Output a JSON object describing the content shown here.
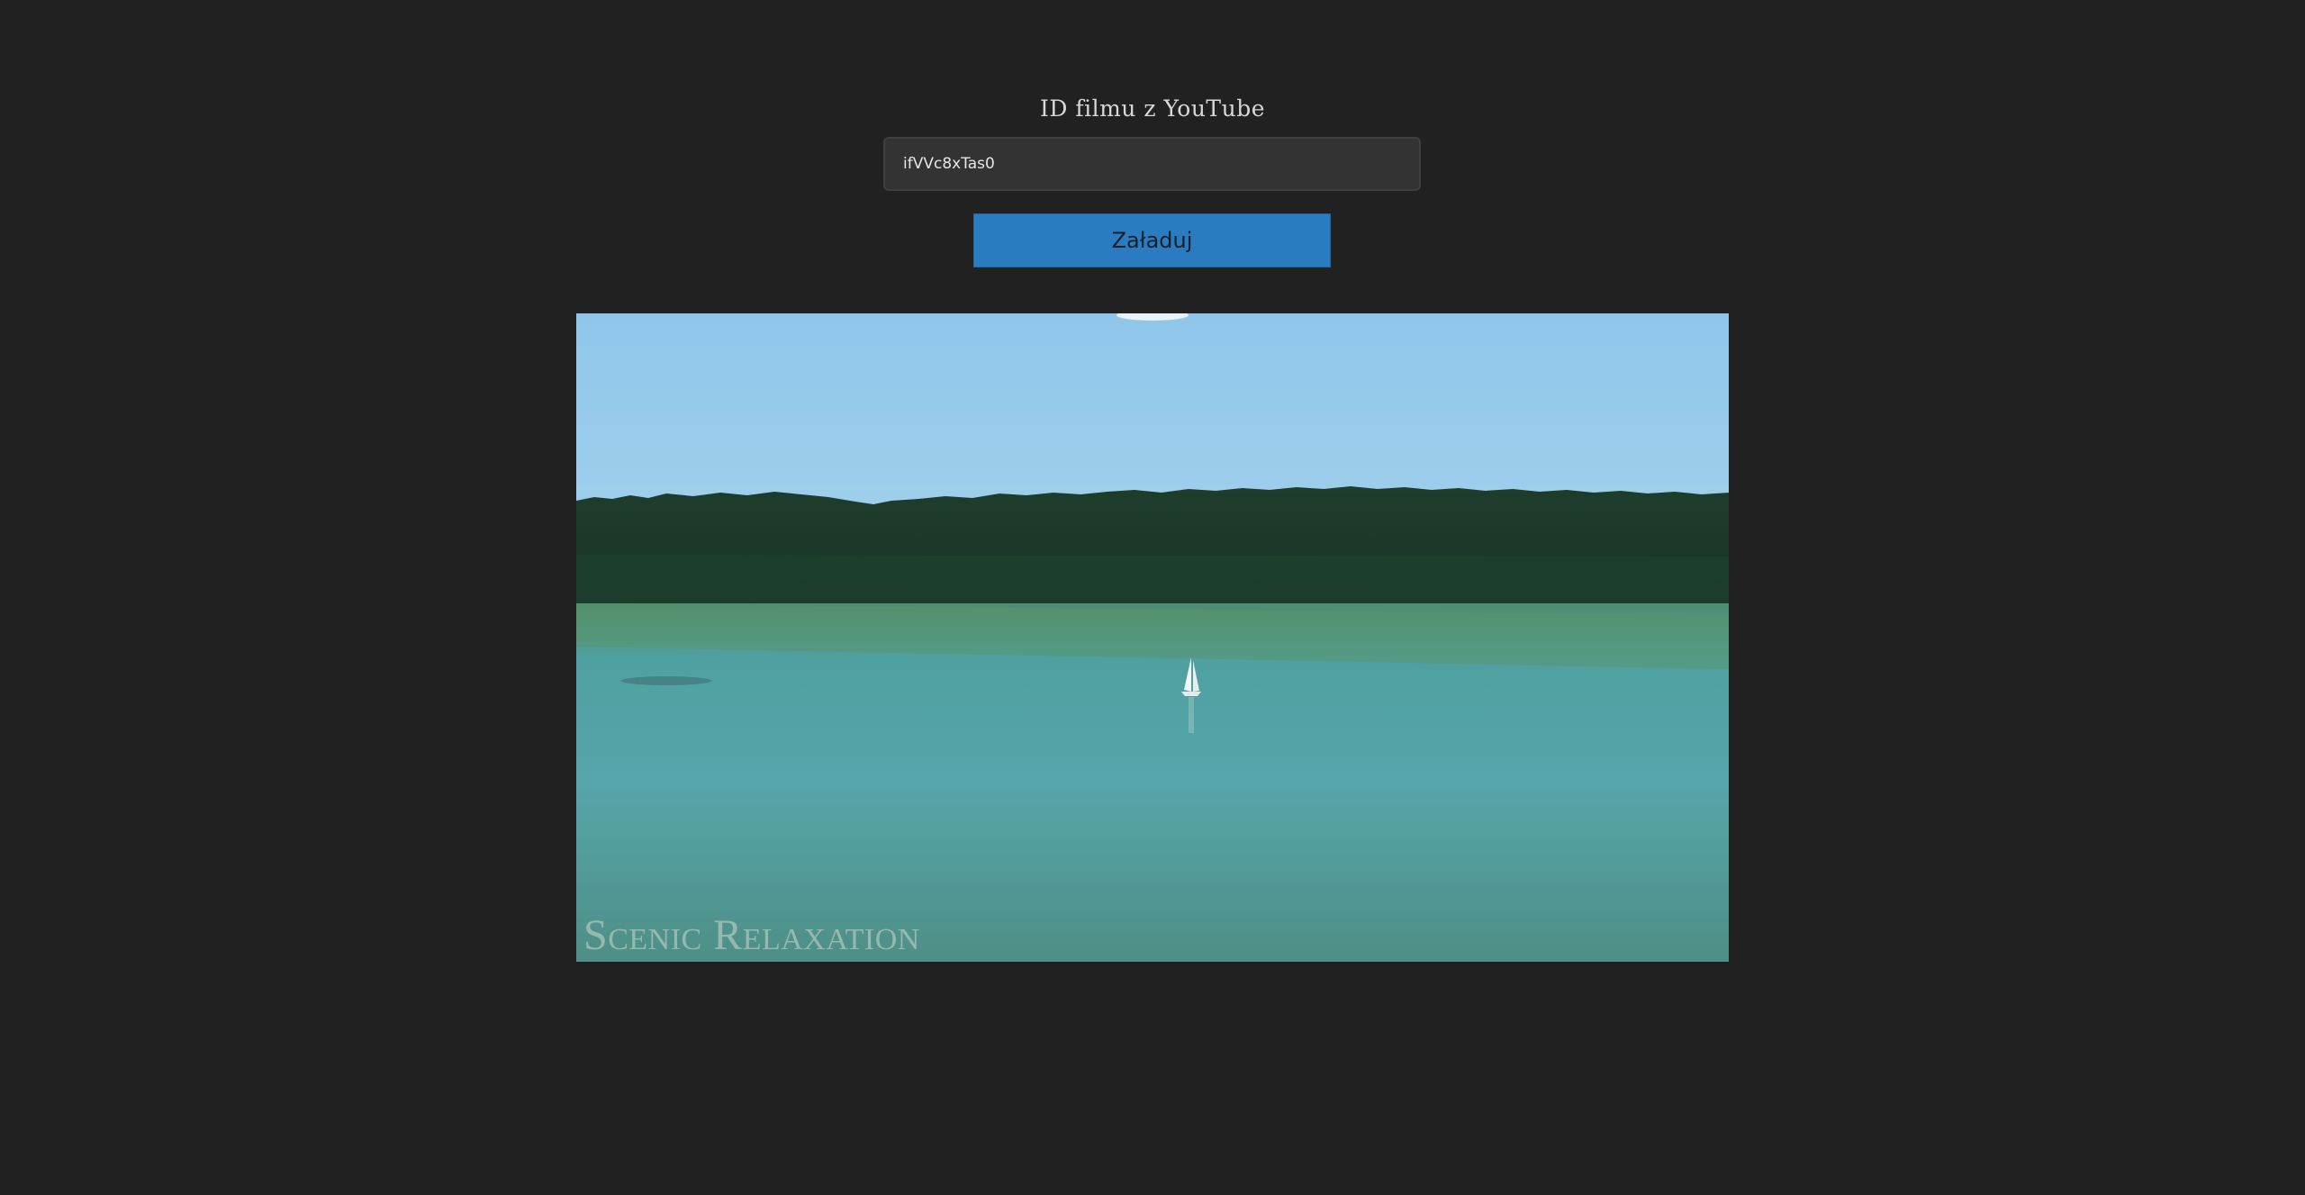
{
  "form": {
    "label": "ID filmu z YouTube",
    "video_id_value": "ifVVc8xTas0",
    "load_button_label": "Załaduj"
  },
  "player": {
    "watermark": "Scenic Relaxation"
  },
  "colors": {
    "background": "#212121",
    "input_background": "#333333",
    "button_accent": "#2a7cc0"
  }
}
